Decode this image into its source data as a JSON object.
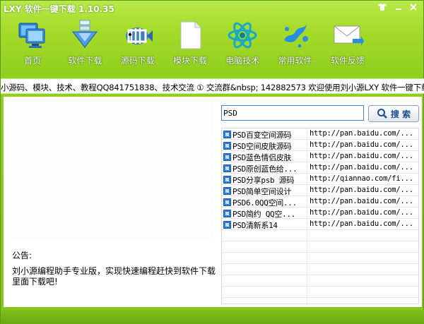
{
  "window": {
    "title": "LXY 软件一键下载 1.10.35",
    "controls": [
      "shirt-icon",
      "minimize-icon",
      "close-icon"
    ]
  },
  "toolbar": {
    "items": [
      {
        "label": "首页",
        "icon": "monitor-icon"
      },
      {
        "label": "软件下载",
        "icon": "download-arrow-icon"
      },
      {
        "label": "源码下载",
        "icon": "fish-icon"
      },
      {
        "label": "模块下载",
        "icon": "document-icon"
      },
      {
        "label": "电脑技术",
        "icon": "atom-icon"
      },
      {
        "label": "常用软件",
        "icon": "splash-icon"
      },
      {
        "label": "软件反馈",
        "icon": "envelope-icon"
      }
    ]
  },
  "marquee": {
    "text": "小源码、模块、技术、教程QQ841751838、技术交流 ① 交流群&nbsp; 142882573 欢迎使用刘小源LXY 软件一键下载"
  },
  "search": {
    "value": "PSD",
    "button_label": "搜 索"
  },
  "results": [
    {
      "name": "PSD百变空间源码",
      "url": "http://pan.baidu.com/..."
    },
    {
      "name": "PSD空间皮肤源码",
      "url": "http://pan.baidu.com/..."
    },
    {
      "name": "PSD蓝色情侣皮肤",
      "url": "http://pan.baidu.com/..."
    },
    {
      "name": "PSD原创蓝色给...",
      "url": "http://pan.baidu.com/..."
    },
    {
      "name": "PSD分享psb 源码",
      "url": "http://qiannao.com/fi..."
    },
    {
      "name": "PSD简单空间设计",
      "url": "http://pan.baidu.com/..."
    },
    {
      "name": "PSD6.0QQ空间...",
      "url": "http://pan.baidu.com/..."
    },
    {
      "name": "PSD简约 QQ空...",
      "url": "http://pan.baidu.com/..."
    },
    {
      "name": "PSD清新系14",
      "url": "http://pan.baidu.com/..."
    }
  ],
  "notice": {
    "title": "公告:",
    "text": "刘小源编程助手专业版，实现快速编程赶快到软件下载里面下载吧!"
  }
}
